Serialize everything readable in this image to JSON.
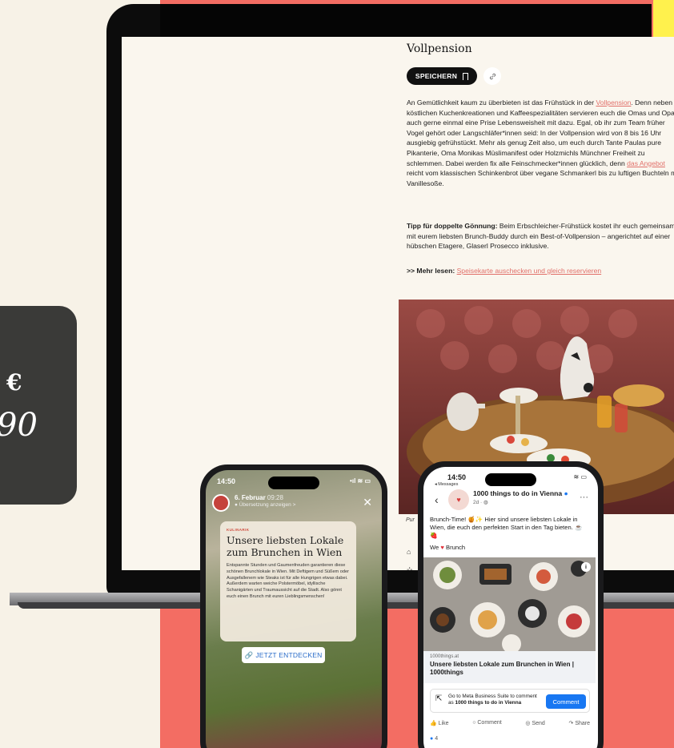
{
  "colors": {
    "background": "#f7f2e7",
    "coral": "#f36d63",
    "yellow": "#fff14d",
    "dark": "#3a3a38",
    "link": "#e1706a",
    "facebook_blue": "#1877f2"
  },
  "price_card": {
    "currency": "€",
    "value": "90"
  },
  "article": {
    "title": "Vollpension",
    "save_label": "SPEICHERN",
    "p1_a": "An Gemütlichkeit kaum zu überbieten ist das Frühstück in der ",
    "p1_link": "Vollpension",
    "p1_b": ". Denn neben köstlichen Kuchenkreationen und Kaffeespezialitäten servieren euch die Omas und Opas auch gerne einmal eine Prise Lebensweisheit mit dazu. Egal, ob ihr zum Team früher Vogel gehört oder Langschläfer*innen seid: In der Vollpension wird von 8 bis 16 Uhr ausgiebig gefrühstückt. Mehr als genug Zeit also, um euch durch Tante Paulas pure Pikanterie, Oma Monikas Müslimanifest oder Holzmichls Münchner Freiheit zu schlemmen. Dabei werden fix alle Feinschmecker*innen glücklich, denn ",
    "p1_link2": "das Angebot",
    "p1_c": " reicht vom klassischen Schinkenbrot über vegane Schmankerl bis zu luftigen Buchteln mit Vanillesoße.",
    "p2_bold": "Tipp für doppelte Gönnung:",
    "p2_text": " Beim Erbschleicher-Frühstück kostet ihr euch gemeinsam mit eurem liebsten Brunch-Buddy durch ein Best-of-Vollpension – angerichtet auf einer hübschen Etagere, Glaserl Prosecco inklusive.",
    "p3_bold": ">> Mehr lesen:",
    "p3_link": "Speisekarte auschecken und gleich reservieren",
    "caption": "Pur"
  },
  "story": {
    "time": "14:50",
    "date": "6. Februar",
    "clock": "09:28",
    "translate": "Übersetzung anzeigen >",
    "kicker": "KULINARIK",
    "title": "Unsere liebsten Lokale zum Brunchen in Wien",
    "body": "Entspannte Stunden und Gaumenfreuden garantieren diese schönen Brunchlokale in Wien. Mit Deftigem und Süßem oder Ausgefallenem wie Steaks ist für alle Hungrigen etwas dabei. Außerdem warten weiche Polstermöbel, idyllische Schanigärten und Traumaussicht auf die Stadt. Also gönnt euch einen Brunch mit euren Lieblingsmenschen!",
    "cta": "JETZT ENTDECKEN"
  },
  "facebook": {
    "time": "14:50",
    "back_label": "◂ Messages",
    "page_name": "1000 things to do in Vienna",
    "meta": "2d · ",
    "post_text": "Brunch-Time! 🍯✨ Hier sind unsere liebsten Lokale in Wien, die euch den perfekten Start in den Tag bieten. ☕🍓",
    "tagline_a": "We",
    "tagline_b": "Brunch",
    "domain": "1000things.at",
    "link_title": "Unsere liebsten Lokale zum Brunchen in Wien | 1000things",
    "meta_text_a": "Go to Meta Business Suite to comment as ",
    "meta_text_b": "1000 things to do in Vienna",
    "comment_btn": "Comment",
    "like": "Like",
    "comment": "Comment",
    "send": "Send",
    "share": "Share",
    "reactions": "4"
  }
}
